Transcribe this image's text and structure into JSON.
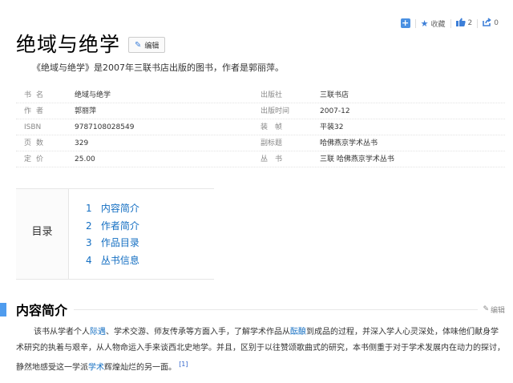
{
  "actions": {
    "collect_label": "收藏",
    "like_count": "2",
    "share_count": "0"
  },
  "title": "绝域与绝学",
  "edit_label": "编辑",
  "summary": "《绝域与绝学》是2007年三联书店出版的图书，作者是郭丽萍。",
  "infobox": [
    {
      "lname": "书名",
      "lvalue": "绝域与绝学",
      "rname": "出版社",
      "rvalue": "三联书店"
    },
    {
      "lname": "作者",
      "lvalue": "郭丽萍",
      "rname": "出版时间",
      "rvalue": "2007-12"
    },
    {
      "lname": "ISBN",
      "lvalue": "9787108028549",
      "rname": "装　帧",
      "rvalue": "平装32"
    },
    {
      "lname": "页数",
      "lvalue": "329",
      "rname": "副标题",
      "rvalue": "哈佛燕京学术丛书"
    },
    {
      "lname": "定价",
      "lvalue": "25.00",
      "rname": "丛　书",
      "rvalue": "三联 哈佛燕京学术丛书"
    }
  ],
  "toc": {
    "heading": "目录",
    "items": [
      {
        "num": "1",
        "label": "内容简介"
      },
      {
        "num": "2",
        "label": "作者简介"
      },
      {
        "num": "3",
        "label": "作品目录"
      },
      {
        "num": "4",
        "label": "丛书信息"
      }
    ]
  },
  "section": {
    "title": "内容简介",
    "edit_label": "编辑",
    "para_1": "该书从学者个人",
    "link_1": "际遇",
    "para_2": "、学术交游、师友传承等方面入手，了解学术作品从",
    "link_2": "酝酿",
    "para_3": "到成品的过程，并深入学人心灵深处，体味他们献身学术研究的执着与艰辛，从人物命运入手来谈西北史地学。并且，区别于以往赞颂歌曲式的研究，本书侧重于对于学术发展内在动力的探讨，静然地感受这一学派",
    "link_3": "学术",
    "para_4": "辉煌灿烂的另一面。",
    "ref": "[1]"
  }
}
